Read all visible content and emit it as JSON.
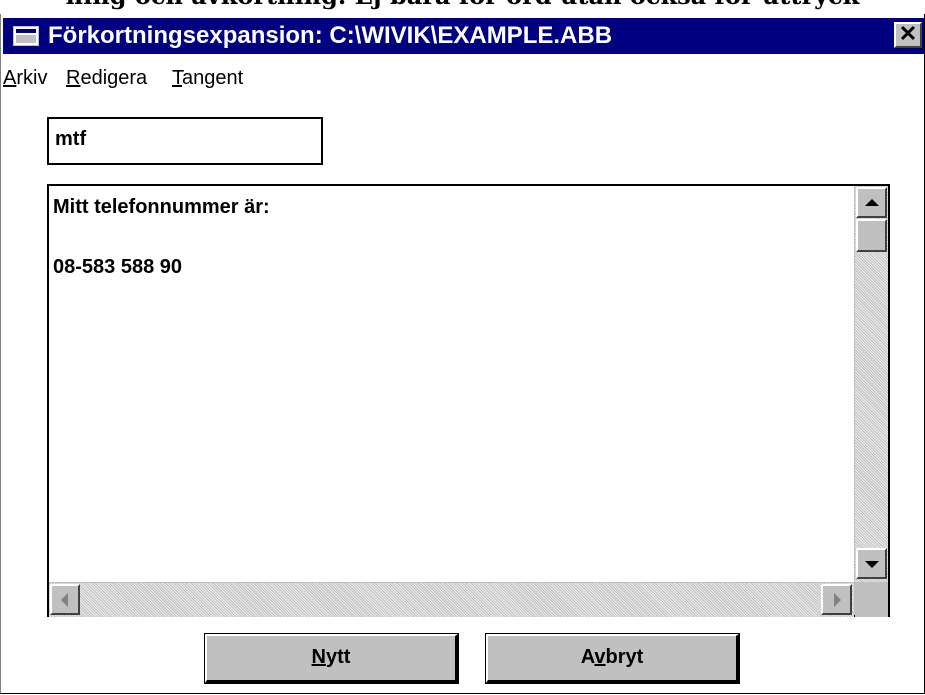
{
  "cropped_heading": "ning och avkortning. Ej bara för ord utan också för uttryck",
  "window": {
    "title": "Förkortningsexpansion: C:\\WIVIK\\EXAMPLE.ABB",
    "close_symbol": "✕"
  },
  "menu": {
    "items": [
      {
        "mnemonic": "A",
        "rest": "rkiv"
      },
      {
        "mnemonic": "R",
        "rest": "edigera"
      },
      {
        "mnemonic": "T",
        "rest": "angent"
      }
    ]
  },
  "abbreviation_field": {
    "value": "mtf"
  },
  "expansion_field": {
    "lines": [
      "Mitt telefonnummer är:",
      "",
      "08-583 588 90"
    ]
  },
  "buttons": {
    "new": {
      "mnemonic": "N",
      "rest": "ytt"
    },
    "cancel": {
      "pre": "A",
      "mnemonic": "v",
      "rest": "bryt"
    }
  },
  "icons": [
    "system-menu-icon",
    "close-icon",
    "scroll-up-arrow-icon",
    "scroll-down-arrow-icon",
    "scroll-left-arrow-icon",
    "scroll-right-arrow-icon"
  ]
}
